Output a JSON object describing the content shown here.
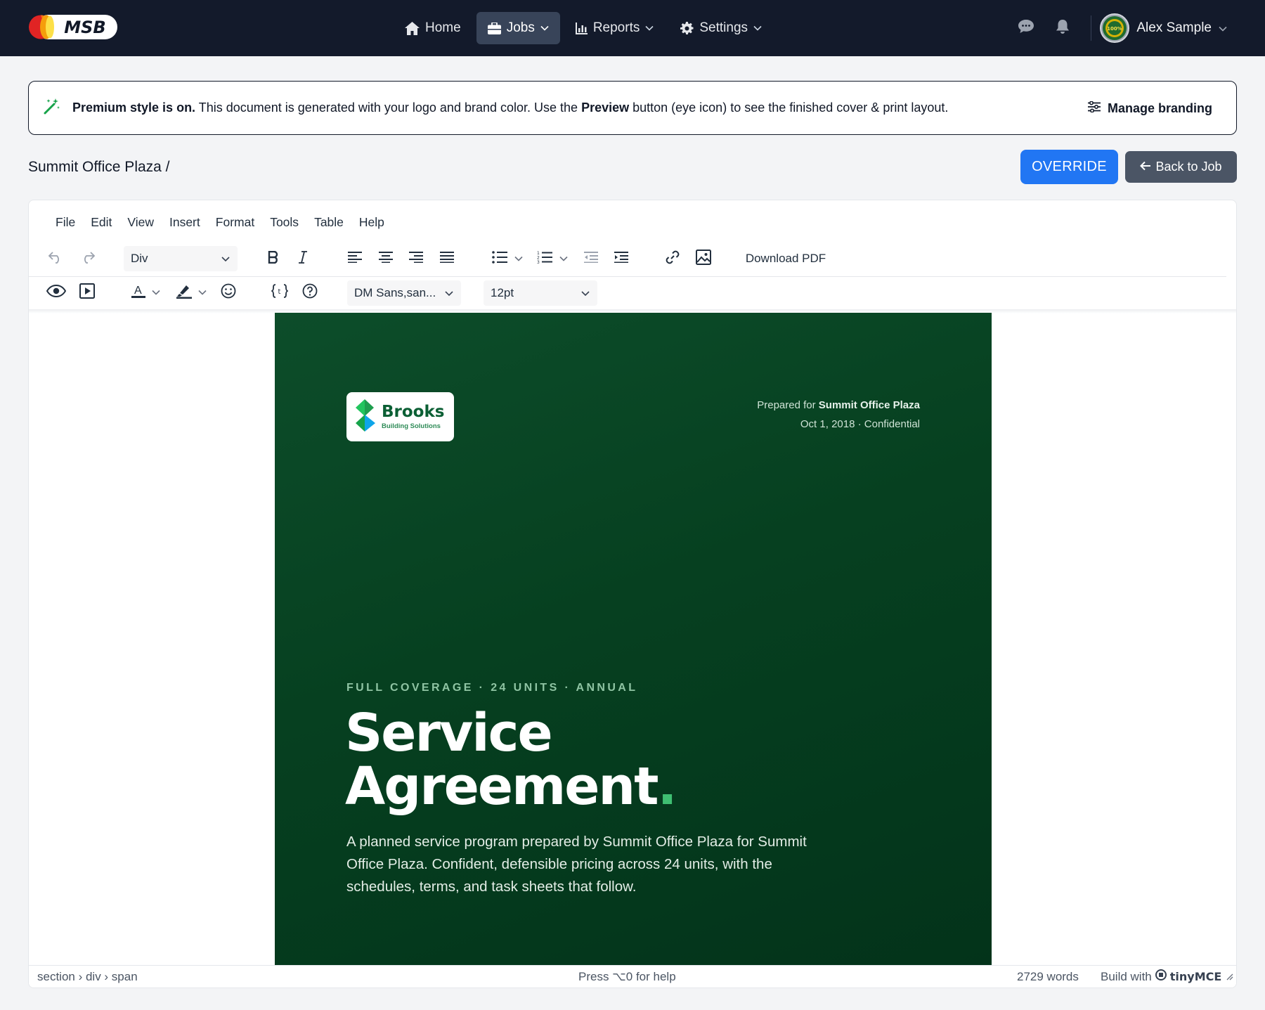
{
  "app": {
    "logo_text": "MSB"
  },
  "nav": {
    "items": [
      {
        "label": "Home",
        "icon": "home-icon"
      },
      {
        "label": "Jobs",
        "icon": "briefcase-icon",
        "active": true
      },
      {
        "label": "Reports",
        "icon": "bar-chart-icon"
      },
      {
        "label": "Settings",
        "icon": "gear-icon"
      }
    ],
    "user_name": "Alex Sample",
    "avatar_text": "100%"
  },
  "banner": {
    "strong": "Premium style is on.",
    "text_1": " This document is generated with your logo and brand color. Use the ",
    "preview_label": "Preview",
    "text_2": " button (eye icon) to see the finished cover & print layout.",
    "manage_label": "Manage branding"
  },
  "breadcrumb": "Summit Office Plaza /",
  "actions": {
    "override_label": "OVERRIDE",
    "back_label": "Back to Job"
  },
  "editor": {
    "menu": [
      "File",
      "Edit",
      "View",
      "Insert",
      "Format",
      "Tools",
      "Table",
      "Help"
    ],
    "block_format": "Div",
    "font_family": "DM Sans,san...",
    "font_size": "12pt",
    "download_label": "Download PDF",
    "status": {
      "path": "section › div › span",
      "help": "Press ⌥0 for help",
      "words": "2729 words",
      "build_prefix": "Build with",
      "build_brand": "tinyMCE"
    }
  },
  "document": {
    "brand_name": "Brooks",
    "brand_sub": "Building Solutions",
    "prepared_prefix": "Prepared for ",
    "prepared_for": "Summit Office Plaza",
    "prepared_line2": "Oct 1, 2018 · Confidential",
    "eyebrow": "FULL COVERAGE · 24 UNITS · ANNUAL",
    "headline_1": "Service",
    "headline_2": "Agreement",
    "headline_dot": ".",
    "lede": "A planned service program prepared by Summit Office Plaza for Summit Office Plaza. Confident, defensible pricing across 24 units, with the schedules, terms, and task sheets that follow."
  },
  "colors": {
    "nav_bg": "#131a2b",
    "accent_blue": "#2176f3",
    "cover_green": "#064020",
    "brand_green": "#0b5f34"
  }
}
